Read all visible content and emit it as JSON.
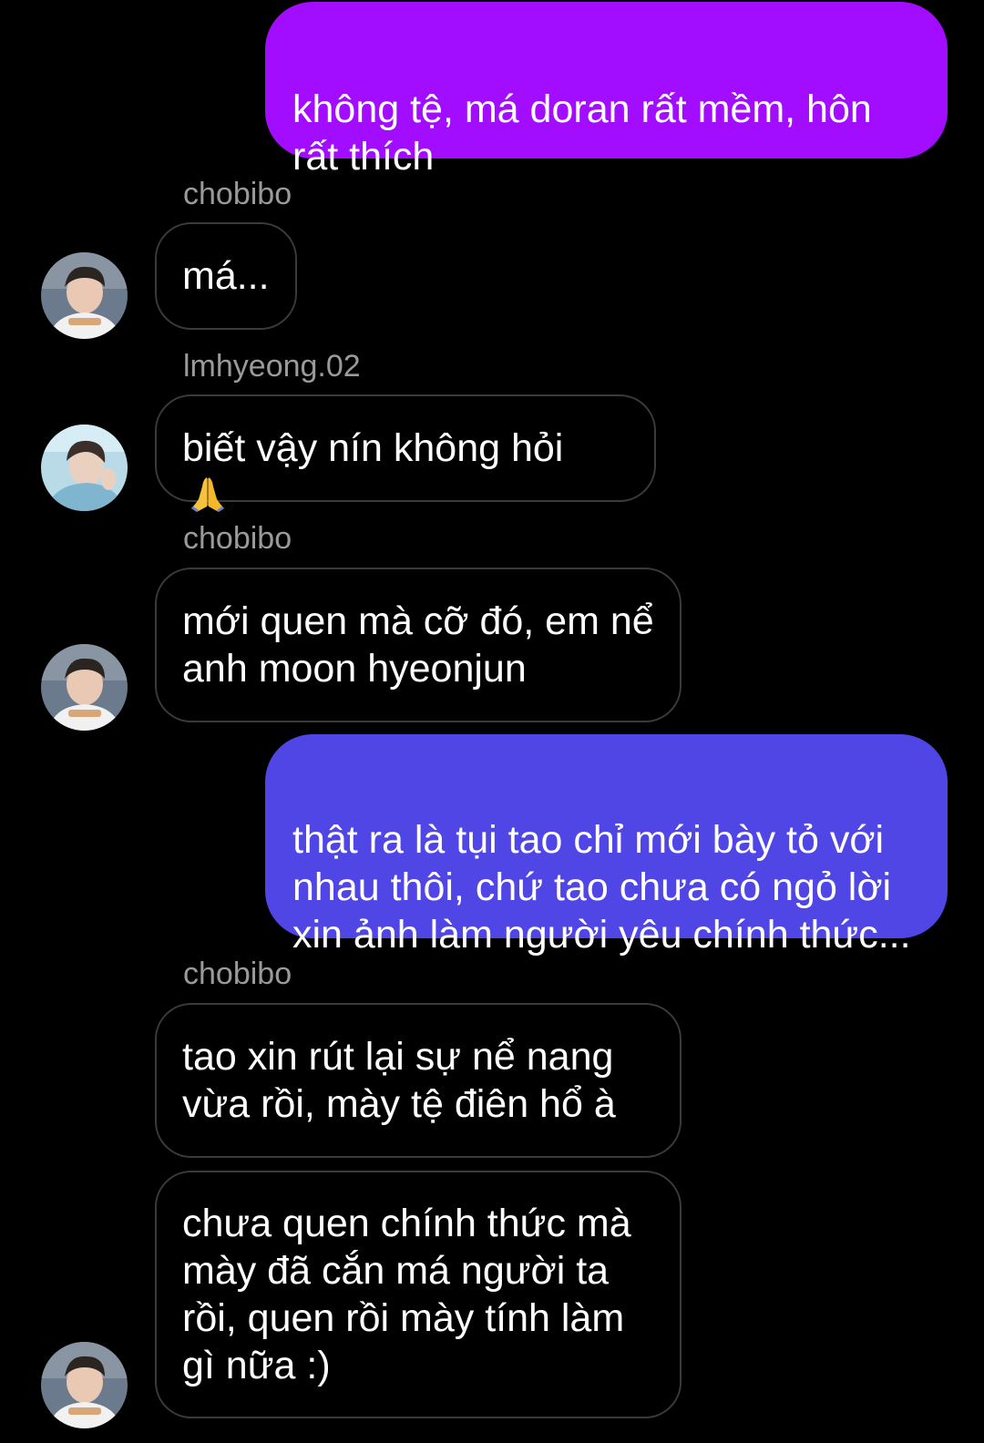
{
  "colors": {
    "background": "#000000",
    "sent_purple": "#a20cff",
    "sent_blue": "#4f46e5",
    "received_border": "#3a3a3a",
    "sender_name": "#9a9a9a"
  },
  "messages": [
    {
      "direction": "sent",
      "text": "không tệ, má doran rất mềm, hôn rất thích"
    },
    {
      "direction": "received",
      "sender": "chobibo",
      "text": "má..."
    },
    {
      "direction": "received",
      "sender": "lmhyeong.02",
      "text": "biết vậy nín không hỏi",
      "emoji": "folded-hands-icon"
    },
    {
      "direction": "received",
      "sender": "chobibo",
      "text": "mới quen mà cỡ đó, em nể anh moon hyeonjun"
    },
    {
      "direction": "sent",
      "text": "thật ra là tụi tao chỉ mới bày tỏ với nhau thôi, chứ tao chưa có ngỏ lời xin ảnh làm người yêu chính thức..."
    },
    {
      "direction": "received",
      "sender": "chobibo",
      "text": "tao xin rút lại sự nể nang vừa rồi, mày tệ điên hổ à"
    },
    {
      "direction": "received",
      "sender": "chobibo",
      "text": "chưa quen chính thức mà mày đã cắn má người ta rồi, quen rồi mày tính làm gì nữa :)"
    }
  ]
}
